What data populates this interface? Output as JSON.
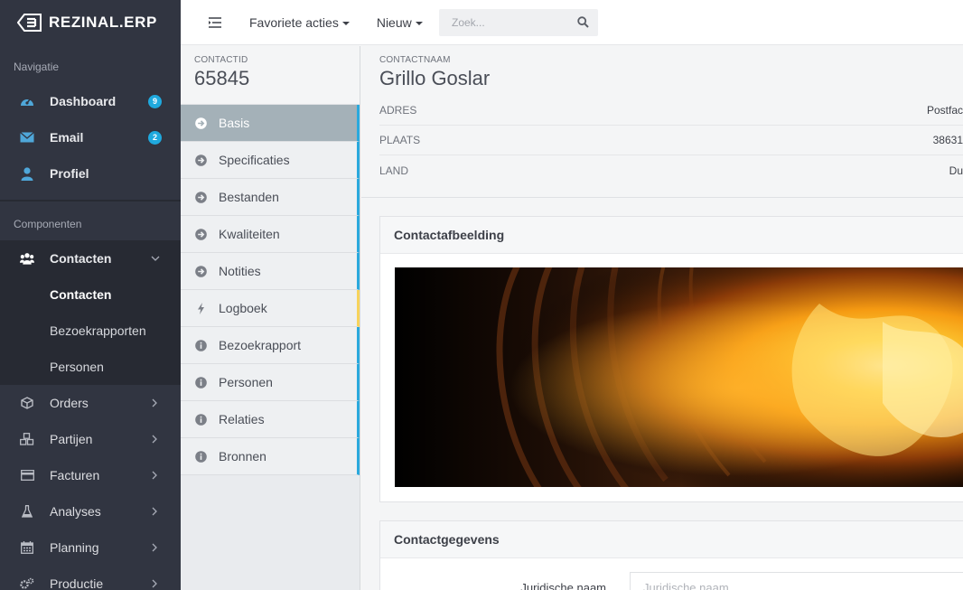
{
  "app": {
    "brand": "REZINAL.ERP"
  },
  "sidebar": {
    "nav_heading": "Navigatie",
    "nav_items": [
      {
        "label": "Dashboard",
        "icon": "dashboard-icon",
        "badge": "9"
      },
      {
        "label": "Email",
        "icon": "envelope-icon",
        "badge": "2"
      },
      {
        "label": "Profiel",
        "icon": "user-icon"
      }
    ],
    "components_heading": "Componenten",
    "contacts": {
      "label": "Contacten",
      "icon": "users-icon",
      "sub_items": [
        "Contacten",
        "Bezoekrapporten",
        "Personen"
      ]
    },
    "more_items": [
      {
        "label": "Orders",
        "icon": "cube-icon"
      },
      {
        "label": "Partijen",
        "icon": "cubes-icon"
      },
      {
        "label": "Facturen",
        "icon": "credit-card-icon"
      },
      {
        "label": "Analyses",
        "icon": "flask-icon"
      },
      {
        "label": "Planning",
        "icon": "calendar-icon"
      },
      {
        "label": "Productie",
        "icon": "cogs-icon"
      }
    ]
  },
  "topbar": {
    "favorites": "Favoriete acties",
    "new": "Nieuw",
    "search_placeholder": "Zoek..."
  },
  "contact": {
    "id_label": "CONTACTID",
    "id": "65845",
    "name_label": "CONTACTNAAM",
    "name": "Grillo Goslar",
    "fields": [
      {
        "key": "ADRES",
        "value": "Postfac"
      },
      {
        "key": "PLAATS",
        "value": "38631"
      },
      {
        "key": "LAND",
        "value": "Du"
      }
    ]
  },
  "tabs": [
    {
      "label": "Basis",
      "icon": "arrow-circle-right-icon"
    },
    {
      "label": "Specificaties",
      "icon": "arrow-circle-right-icon"
    },
    {
      "label": "Bestanden",
      "icon": "arrow-circle-right-icon"
    },
    {
      "label": "Kwaliteiten",
      "icon": "arrow-circle-right-icon"
    },
    {
      "label": "Notities",
      "icon": "arrow-circle-right-icon"
    },
    {
      "label": "Logboek",
      "icon": "bolt-icon"
    },
    {
      "label": "Bezoekrapport",
      "icon": "info-circle-icon"
    },
    {
      "label": "Personen",
      "icon": "info-circle-icon"
    },
    {
      "label": "Relaties",
      "icon": "info-circle-icon"
    },
    {
      "label": "Bronnen",
      "icon": "info-circle-icon"
    }
  ],
  "panels": {
    "image_title": "Contactafbeelding",
    "details_title": "Contactgegevens",
    "legal_name_label": "Juridische naam",
    "legal_name_placeholder": "Juridische naam"
  },
  "colors": {
    "sidebar_bg": "#313541",
    "accent_blue": "#1fa9de",
    "active_tab": "#a4b1b8",
    "warn_yellow": "#f7d35c"
  }
}
